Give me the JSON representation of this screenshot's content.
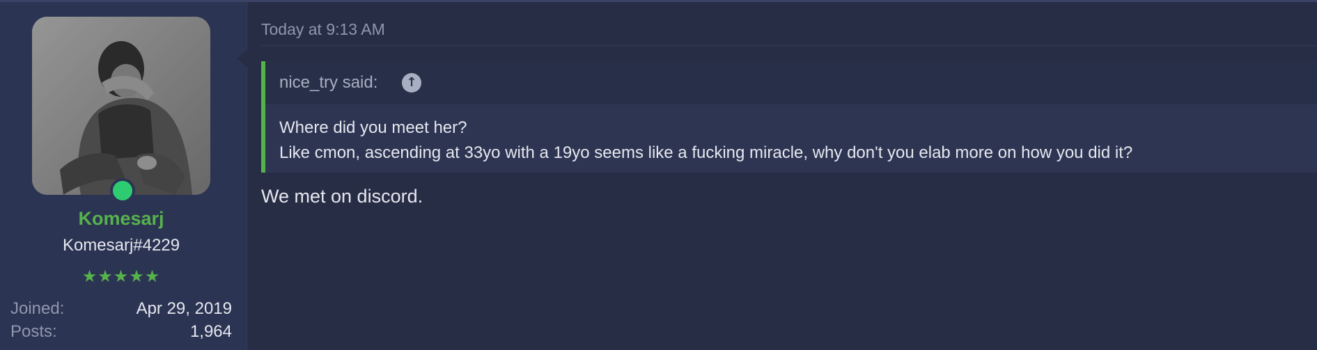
{
  "user": {
    "username": "Komesarj",
    "user_title": "Komesarj#4229",
    "rating_stars": "★★★★★",
    "status": "online",
    "stats": [
      {
        "label": "Joined:",
        "value": "Apr 29, 2019"
      },
      {
        "label": "Posts:",
        "value": "1,964"
      }
    ]
  },
  "post": {
    "timestamp": "Today at 9:13 AM",
    "quote": {
      "author_line": "nice_try said:",
      "jump_icon": "arrow-up-circle-icon",
      "lines": [
        "Where did you meet her?",
        "Like cmon, ascending at 33yo with a 19yo seems like a fucking miracle, why don't you elab more on how you did it?"
      ]
    },
    "message": "We met on discord."
  },
  "colors": {
    "accent_green": "#56b34c",
    "online_green": "#2ecc71",
    "background": "#272d45",
    "sidebar": "#2c3453"
  }
}
